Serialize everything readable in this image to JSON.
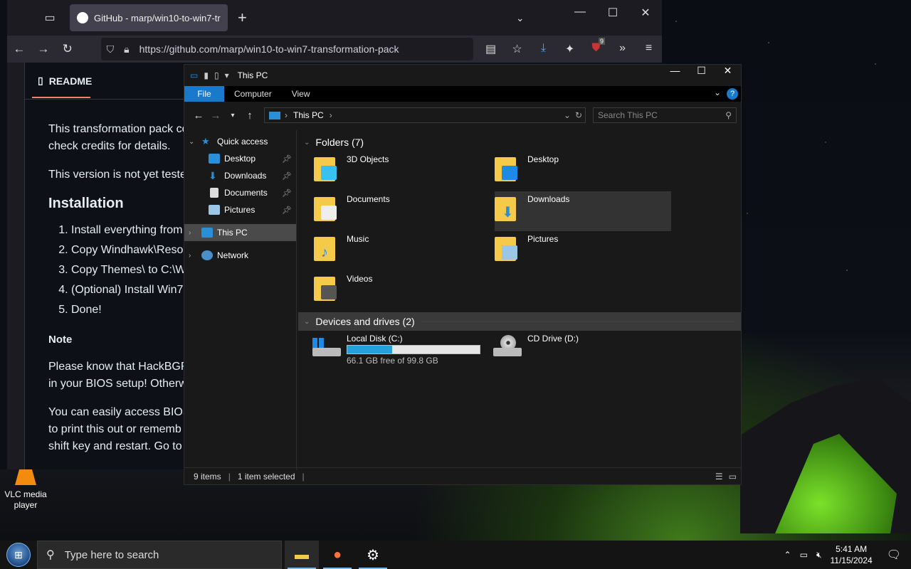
{
  "browser": {
    "tab_title": "GitHub - marp/win10-to-win7-tr",
    "url": "https://github.com/marp/win10-to-win7-transformation-pack",
    "extension_badge": "9",
    "readme_tab": "README",
    "readme": {
      "p1_line1": "This transformation pack co",
      "p1_line2": "check credits for details.",
      "p2": "This version is not yet teste",
      "h_install": "Installation",
      "steps": [
        "Install everything from",
        "Copy Windhawk\\Resou",
        "Copy Themes\\ to C:\\W",
        "(Optional) Install Win7",
        "Done!"
      ],
      "h_note": "Note",
      "p3_line1": "Please know that HackBGRT",
      "p3_line2": "in your BIOS setup! Otherw",
      "p4_line1": "You can easily access BIOS",
      "p4_line2": "to print this out or rememb",
      "p4_line3": "shift key and restart. Go to"
    }
  },
  "explorer": {
    "title": "This PC",
    "ribbon_tabs": {
      "file": "File",
      "computer": "Computer",
      "view": "View"
    },
    "help": "?",
    "address_path": "This PC",
    "search_placeholder": "Search This PC",
    "nav": {
      "quick_access": "Quick access",
      "desktop": "Desktop",
      "downloads": "Downloads",
      "documents": "Documents",
      "pictures": "Pictures",
      "this_pc": "This PC",
      "network": "Network"
    },
    "folders_header": "Folders (7)",
    "folders": [
      "3D Objects",
      "Desktop",
      "Documents",
      "Downloads",
      "Music",
      "Pictures",
      "Videos"
    ],
    "devices_header": "Devices and drives (2)",
    "drives": {
      "c_name": "Local Disk (C:)",
      "c_free": "66.1 GB free of 99.8 GB",
      "c_used_fraction": 0.34,
      "d_name": "CD Drive (D:)"
    },
    "status": {
      "items": "9 items",
      "selected": "1 item selected"
    }
  },
  "desktop": {
    "vlc_label": "VLC media player"
  },
  "taskbar": {
    "search_placeholder": "Type here to search",
    "time": "5:41 AM",
    "date": "11/15/2024"
  },
  "colors": {
    "accent": "#1979ca",
    "drive_fill": "#26a0da",
    "folder": "#f5c94a"
  }
}
